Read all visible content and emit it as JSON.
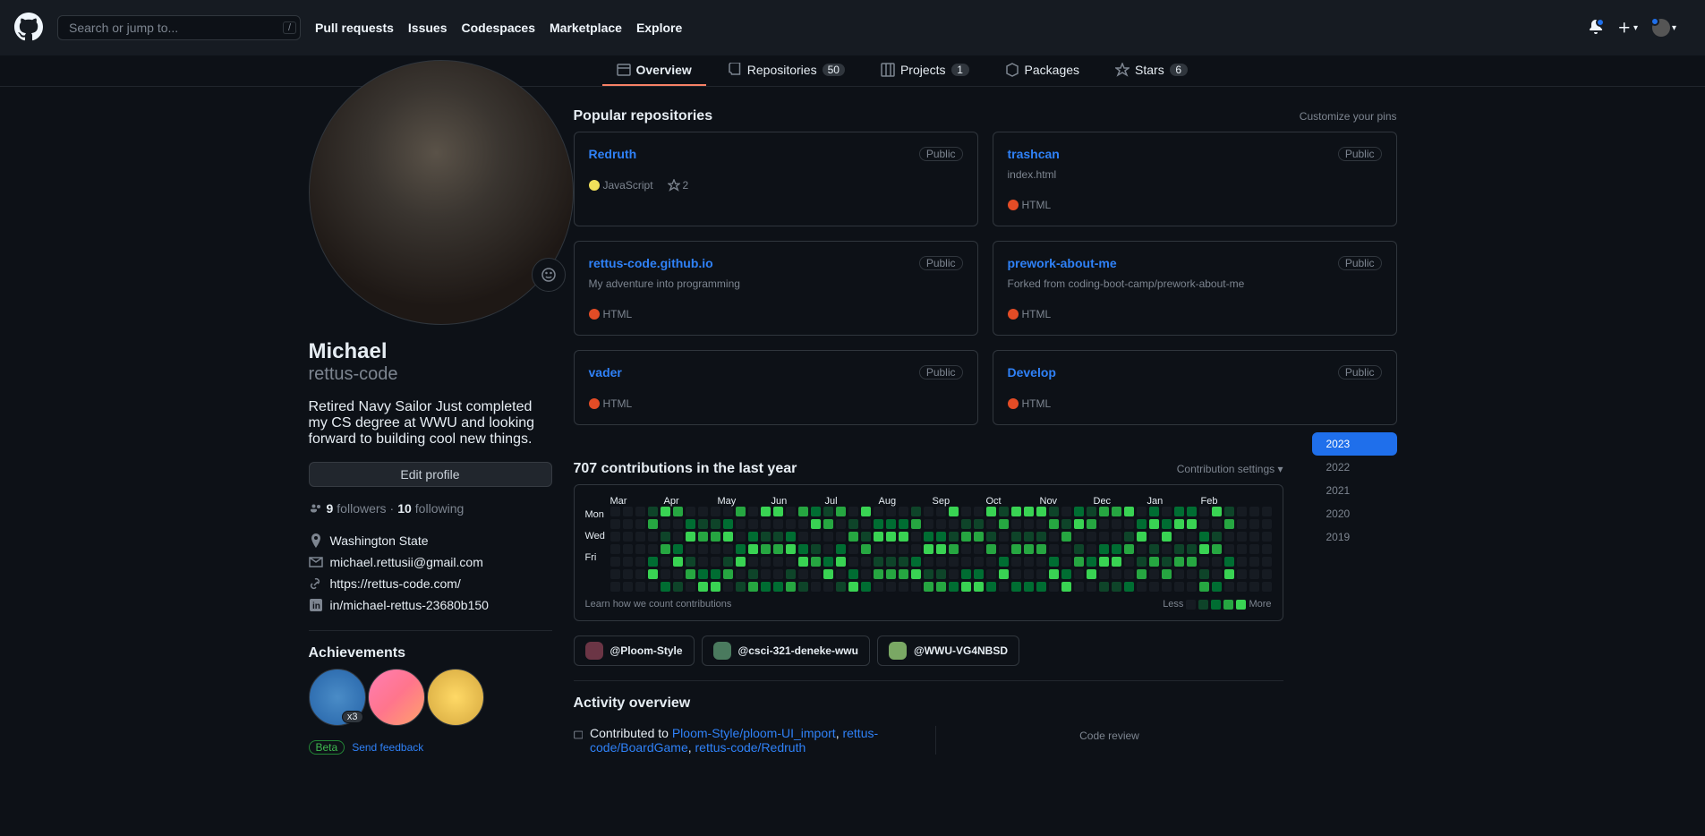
{
  "header": {
    "search_placeholder": "Search or jump to...",
    "search_kbd": "/",
    "nav": [
      "Pull requests",
      "Issues",
      "Codespaces",
      "Marketplace",
      "Explore"
    ]
  },
  "tabs": {
    "overview": "Overview",
    "repos": "Repositories",
    "repos_count": "50",
    "projects": "Projects",
    "projects_count": "1",
    "packages": "Packages",
    "stars": "Stars",
    "stars_count": "6"
  },
  "profile": {
    "name": "Michael",
    "username": "rettus-code",
    "bio": "Retired Navy Sailor Just completed my CS degree at WWU and looking forward to building cool new things.",
    "edit": "Edit profile",
    "followers_n": "9",
    "followers_l": " followers",
    "sep": " · ",
    "following_n": "10",
    "following_l": " following",
    "location": "Washington State",
    "email": "michael.rettusii@gmail.com",
    "url": "https://rettus-code.com/",
    "linkedin": "in/michael-rettus-23680b150",
    "achievements": "Achievements",
    "badge_count": "x3",
    "beta": "Beta",
    "feedback": "Send feedback"
  },
  "popular": {
    "title": "Popular repositories",
    "customize": "Customize your pins",
    "items": [
      {
        "name": "Redruth",
        "desc": "",
        "lang": "JavaScript",
        "langc": "js",
        "stars": "2",
        "vis": "Public"
      },
      {
        "name": "trashcan",
        "desc": "index.html",
        "lang": "HTML",
        "langc": "html",
        "stars": "",
        "vis": "Public"
      },
      {
        "name": "rettus-code.github.io",
        "desc": "My adventure into programming",
        "lang": "HTML",
        "langc": "html",
        "stars": "",
        "vis": "Public"
      },
      {
        "name": "prework-about-me",
        "desc": "Forked from coding-boot-camp/prework-about-me",
        "lang": "HTML",
        "langc": "html",
        "stars": "",
        "vis": "Public"
      },
      {
        "name": "vader",
        "desc": "",
        "lang": "HTML",
        "langc": "html",
        "stars": "",
        "vis": "Public"
      },
      {
        "name": "Develop",
        "desc": "",
        "lang": "HTML",
        "langc": "html",
        "stars": "",
        "vis": "Public"
      }
    ]
  },
  "contrib": {
    "title": "707 contributions in the last year",
    "settings": "Contribution settings",
    "months": [
      "Mar",
      "Apr",
      "May",
      "Jun",
      "Jul",
      "Aug",
      "Sep",
      "Oct",
      "Nov",
      "Dec",
      "Jan",
      "Feb"
    ],
    "days": [
      "Mon",
      "Wed",
      "Fri"
    ],
    "learn": "Learn how we count contributions",
    "less": "Less",
    "more": "More",
    "years": [
      "2023",
      "2022",
      "2021",
      "2020",
      "2019"
    ]
  },
  "orgs": [
    "@Ploom-Style",
    "@csci-321-deneke-wwu",
    "@WWU-VG4NBSD"
  ],
  "activity": {
    "title": "Activity overview",
    "contributed": "Contributed to ",
    "r1": "Ploom-Style/ploom-UI_import",
    "r2": "rettus-code/BoardGame",
    "r3": "rettus-code/Redruth",
    "code_review": "Code review"
  }
}
